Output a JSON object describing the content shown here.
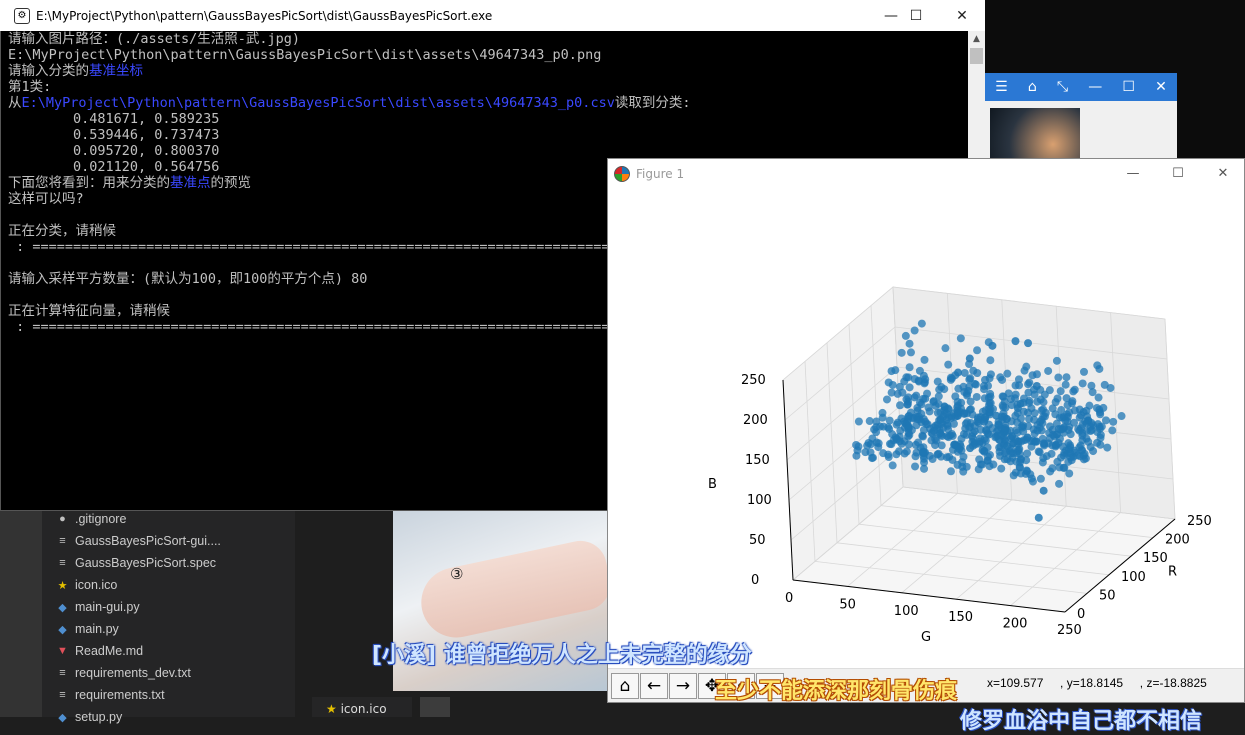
{
  "console": {
    "title": "E:\\MyProject\\Python\\pattern\\GaussBayesPicSort\\dist\\GaussBayesPicSort.exe",
    "lines": [
      [
        {
          "t": "请输入图片路径：(./assets/生活照-武.jpg)"
        }
      ],
      [
        {
          "t": "E:\\MyProject\\Python\\pattern\\GaussBayesPicSort\\dist\\assets\\49647343_p0.png"
        }
      ],
      [
        {
          "t": "请输入分类的"
        },
        {
          "t": "基准坐标",
          "c": "blue"
        }
      ],
      [
        {
          "t": "第1类:"
        }
      ],
      [
        {
          "t": "从"
        },
        {
          "t": "E:\\MyProject\\Python\\pattern\\GaussBayesPicSort\\dist\\assets\\49647343_p0.csv",
          "c": "blue"
        },
        {
          "t": "读取到分类:"
        }
      ],
      [
        {
          "t": "        0.481671, 0.589235"
        }
      ],
      [
        {
          "t": "        0.539446, 0.737473"
        }
      ],
      [
        {
          "t": "        0.095720, 0.800370"
        }
      ],
      [
        {
          "t": "        0.021120, 0.564756"
        }
      ],
      [
        {
          "t": "下面您将看到：用来分类的"
        },
        {
          "t": "基准点",
          "c": "blue"
        },
        {
          "t": "的预览"
        }
      ],
      [
        {
          "t": "这样可以吗?"
        }
      ],
      [
        {
          "t": ""
        }
      ],
      [
        {
          "t": "正在分类，请稍候"
        }
      ],
      [
        {
          "t": " : ========================================================================"
        }
      ],
      [
        {
          "t": ""
        }
      ],
      [
        {
          "t": "请输入采样平方数量：(默认为100，即100的平方个点) 80"
        }
      ],
      [
        {
          "t": ""
        }
      ],
      [
        {
          "t": "正在计算特征向量，请稍候"
        }
      ],
      [
        {
          "t": " : ========================================================================"
        }
      ]
    ]
  },
  "figure": {
    "title": "Figure 1",
    "coords": "x=109.577     , y=18.8145     , z=-18.8825"
  },
  "chart_data": {
    "type": "scatter",
    "projection": "3d",
    "title": "",
    "xlabel": "R",
    "ylabel": "G",
    "zlabel": "B",
    "xlim": [
      0,
      250
    ],
    "ylim": [
      0,
      250
    ],
    "zlim": [
      0,
      250
    ],
    "xticks": [
      "0",
      "50",
      "100",
      "150",
      "200",
      "250"
    ],
    "yticks": [
      "0",
      "50",
      "100",
      "150",
      "200",
      "250"
    ],
    "zticks": [
      "0",
      "50",
      "100",
      "150",
      "200",
      "250"
    ],
    "color": "#1f77b4",
    "grid": true,
    "points_sample": [
      [
        230,
        200,
        150
      ],
      [
        235,
        180,
        160
      ],
      [
        240,
        210,
        200
      ],
      [
        220,
        190,
        140
      ],
      [
        200,
        160,
        120
      ],
      [
        180,
        150,
        110
      ],
      [
        160,
        130,
        100
      ],
      [
        140,
        110,
        90
      ],
      [
        120,
        100,
        80
      ],
      [
        100,
        90,
        70
      ],
      [
        220,
        220,
        220
      ],
      [
        210,
        200,
        190
      ],
      [
        190,
        170,
        150
      ],
      [
        170,
        160,
        150
      ],
      [
        150,
        140,
        130
      ],
      [
        60,
        80,
        140
      ],
      [
        80,
        100,
        170
      ],
      [
        100,
        130,
        200
      ],
      [
        120,
        160,
        220
      ],
      [
        140,
        180,
        230
      ],
      [
        50,
        40,
        30
      ],
      [
        70,
        50,
        40
      ],
      [
        90,
        70,
        50
      ],
      [
        240,
        230,
        100
      ],
      [
        230,
        220,
        60
      ]
    ]
  },
  "files": [
    {
      "name": ".gitignore",
      "icon": "git-icon"
    },
    {
      "name": "GaussBayesPicSort-gui....",
      "icon": "lines-icon"
    },
    {
      "name": "GaussBayesPicSort.spec",
      "icon": "lines-icon"
    },
    {
      "name": "icon.ico",
      "icon": "star-icon"
    },
    {
      "name": "main-gui.py",
      "icon": "python-icon"
    },
    {
      "name": "main.py",
      "icon": "python-icon"
    },
    {
      "name": "ReadMe.md",
      "icon": "markdown-icon"
    },
    {
      "name": "requirements_dev.txt",
      "icon": "lines-icon"
    },
    {
      "name": "requirements.txt",
      "icon": "lines-icon"
    },
    {
      "name": "setup.py",
      "icon": "python-icon"
    }
  ],
  "editor_tab": {
    "label": "icon.ico"
  },
  "overlay": {
    "circled": "③"
  },
  "subtitles": {
    "line1": "[小溪] 谁曾拒绝万人之上未完整的缘分",
    "line2": "至少不能添深那刻骨伤痕",
    "line3": "修罗血浴中自己都不相信"
  }
}
